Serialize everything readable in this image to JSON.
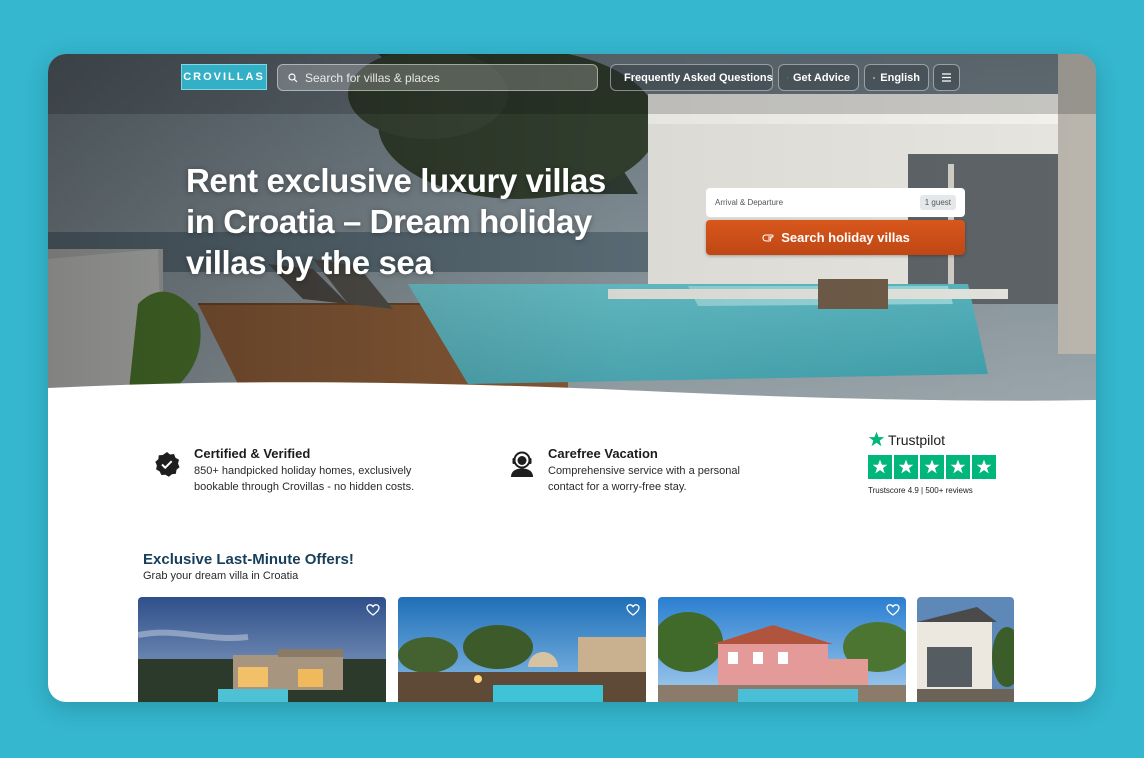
{
  "brand": {
    "logo": "CROVILLAS"
  },
  "nav": {
    "search_placeholder": "Search for villas & places",
    "faq": "Frequently Asked Questions",
    "advice": "Get Advice",
    "language": "English"
  },
  "hero": {
    "title": "Rent exclusive luxury villas in Croatia – Dream holiday villas by the sea",
    "date_label": "Arrival & Departure",
    "guests": "1 guest",
    "cta": "Search holiday villas"
  },
  "features": [
    {
      "title": "Certified & Verified",
      "text": "850+ handpicked holiday homes, exclusively bookable through Crovillas - no hidden costs.",
      "icon": "verified-badge-icon"
    },
    {
      "title": "Carefree Vacation",
      "text": "Comprehensive service with a personal contact for a worry-free stay.",
      "icon": "support-agent-icon"
    }
  ],
  "trustpilot": {
    "name": "Trustpilot",
    "stars": 5,
    "score_text": "Trustscore 4.9 | 500+ reviews"
  },
  "offers": {
    "title": "Exclusive Last-Minute Offers!",
    "subtitle": "Grab your dream villa in Croatia"
  },
  "colors": {
    "background": "#34b7cf",
    "accent": "#34b0c6",
    "cta": "#cf5118",
    "trustpilot_green": "#00b67a",
    "heading_navy": "#173f5a"
  }
}
